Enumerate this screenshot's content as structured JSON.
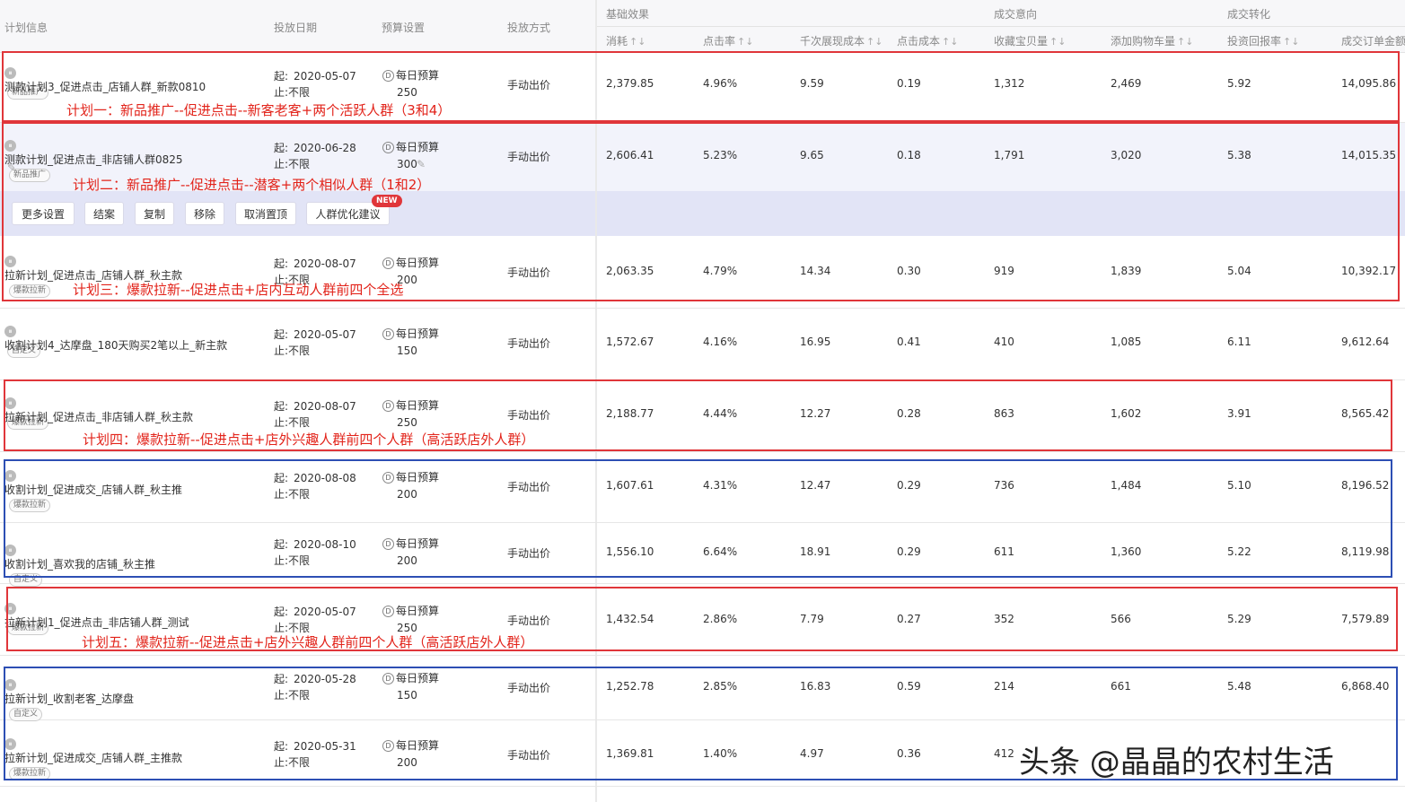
{
  "header": {
    "col_plan": "计划信息",
    "col_date": "投放日期",
    "col_budget": "预算设置",
    "col_method": "投放方式",
    "group_basic": "基础效果",
    "group_intent": "成交意向",
    "group_conv": "成交转化",
    "metrics": [
      "消耗",
      "点击率",
      "千次展现成本",
      "点击成本",
      "收藏宝贝量",
      "添加购物车量",
      "投资回报率",
      "成交订单金额"
    ]
  },
  "labels": {
    "start_prefix": "起:",
    "end_prefix": "止:",
    "end_value": "不限",
    "budget_type": "每日预算",
    "method": "手动出价"
  },
  "rows": [
    {
      "name": "测款计划3_促进点击_店铺人群_新款0810",
      "tag": "新品推广",
      "start": "2020-05-07",
      "budget": "250",
      "m": [
        "2,379.85",
        "4.96%",
        "9.59",
        "0.19",
        "1,312",
        "2,469",
        "5.92",
        "14,095.86"
      ]
    },
    {
      "name": "测款计划_促进点击_非店铺人群0825",
      "tag": "新品推广",
      "start": "2020-06-28",
      "budget": "300",
      "m": [
        "2,606.41",
        "5.23%",
        "9.65",
        "0.18",
        "1,791",
        "3,020",
        "5.38",
        "14,015.35"
      ]
    },
    {
      "name": "拉新计划_促进点击_店铺人群_秋主款",
      "tag": "爆款拉新",
      "start": "2020-08-07",
      "budget": "200",
      "m": [
        "2,063.35",
        "4.79%",
        "14.34",
        "0.30",
        "919",
        "1,839",
        "5.04",
        "10,392.17"
      ]
    },
    {
      "name": "收割计划4_达摩盘_180天购买2笔以上_新主款",
      "tag": "自定义",
      "start": "2020-05-07",
      "budget": "150",
      "m": [
        "1,572.67",
        "4.16%",
        "16.95",
        "0.41",
        "410",
        "1,085",
        "6.11",
        "9,612.64"
      ]
    },
    {
      "name": "拉新计划_促进点击_非店铺人群_秋主款",
      "tag": "爆款拉新",
      "start": "2020-08-07",
      "budget": "250",
      "m": [
        "2,188.77",
        "4.44%",
        "12.27",
        "0.28",
        "863",
        "1,602",
        "3.91",
        "8,565.42"
      ]
    },
    {
      "name": "收割计划_促进成交_店铺人群_秋主推",
      "tag": "爆款拉新",
      "start": "2020-08-08",
      "budget": "200",
      "m": [
        "1,607.61",
        "4.31%",
        "12.47",
        "0.29",
        "736",
        "1,484",
        "5.10",
        "8,196.52"
      ]
    },
    {
      "name": "收割计划_喜欢我的店铺_秋主推",
      "tag": "自定义",
      "start": "2020-08-10",
      "budget": "200",
      "m": [
        "1,556.10",
        "6.64%",
        "18.91",
        "0.29",
        "611",
        "1,360",
        "5.22",
        "8,119.98"
      ]
    },
    {
      "name": "拉新计划1_促进点击_非店铺人群_测试",
      "tag": "爆款拉新",
      "start": "2020-05-07",
      "budget": "250",
      "m": [
        "1,432.54",
        "2.86%",
        "7.79",
        "0.27",
        "352",
        "566",
        "5.29",
        "7,579.89"
      ]
    },
    {
      "name": "拉新计划_收割老客_达摩盘",
      "tag": "自定义",
      "start": "2020-05-28",
      "budget": "150",
      "m": [
        "1,252.78",
        "2.85%",
        "16.83",
        "0.59",
        "214",
        "661",
        "5.48",
        "6,868.40"
      ]
    },
    {
      "name": "拉新计划_促进成交_店铺人群_主推款",
      "tag": "爆款拉新",
      "start": "2020-05-31",
      "budget": "200",
      "m": [
        "1,369.81",
        "1.40%",
        "4.97",
        "0.36",
        "412",
        "",
        "",
        ""
      ]
    }
  ],
  "actions": [
    "更多设置",
    "结案",
    "复制",
    "移除",
    "取消置顶",
    "人群优化建议"
  ],
  "new_badge": "NEW",
  "annotations": [
    "计划一：新品推广--促进点击--新客老客+两个活跃人群（3和4）",
    "计划二：新品推广--促进点击--潜客+两个相似人群（1和2）",
    "计划三：爆款拉新--促进点击+店内互动人群前四个全选",
    "计划四：爆款拉新--促进点击+店外兴趣人群前四个人群（高活跃店外人群）",
    "计划五：爆款拉新--促进点击+店外兴趣人群前四个人群（高活跃店外人群）"
  ],
  "watermark": "头条 @晶晶的农村生活",
  "colors": {
    "red_box": "#e0363a",
    "blue_box": "#2d4fb4",
    "annotation": "#e2231a",
    "highlight": "#e7e8f7"
  }
}
